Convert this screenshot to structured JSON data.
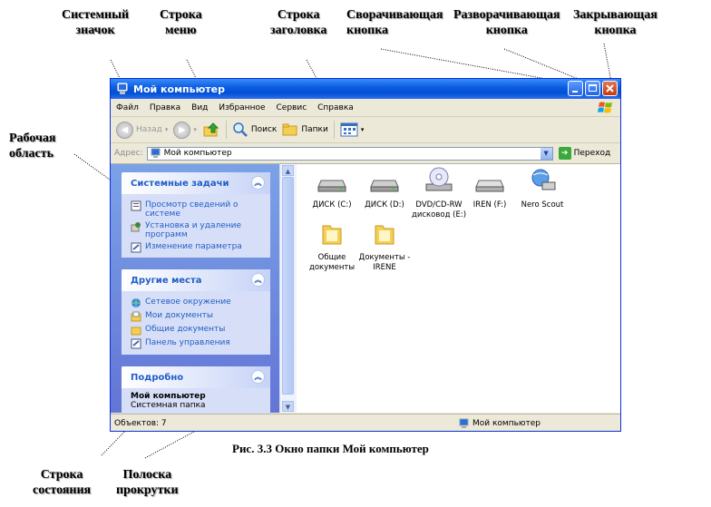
{
  "annotations": {
    "system_icon": "Системный\nзначок",
    "menu_bar": "Строка\nменю",
    "title_bar": "Строка\nзаголовка",
    "minimize_button": "Сворачивающая\nкнопка",
    "maximize_button": "Разворачивающая\nкнопка",
    "close_button": "Закрывающая\nкнопка",
    "work_area": "Рабочая\nобласть",
    "status_bar": "Строка\nсостояния",
    "scroll_bar": "Полоска\nпрокрутки"
  },
  "window": {
    "title": "Мой компьютер",
    "menu": [
      "Файл",
      "Правка",
      "Вид",
      "Избранное",
      "Сервис",
      "Справка"
    ],
    "toolbar": {
      "back": "Назад",
      "search": "Поиск",
      "folders": "Папки"
    },
    "address": {
      "label": "Адрес:",
      "value": "Мой компьютер",
      "go": "Переход"
    },
    "tasks": {
      "system": {
        "title": "Системные задачи",
        "items": [
          "Просмотр сведений о системе",
          "Установка и удаление программ",
          "Изменение параметра"
        ]
      },
      "places": {
        "title": "Другие места",
        "items": [
          "Сетевое окружение",
          "Мои документы",
          "Общие документы",
          "Панель управления"
        ]
      },
      "details": {
        "title": "Подробно",
        "name": "Мой компьютер",
        "type": "Системная папка"
      }
    },
    "files": [
      {
        "label": "ДИСК (C:)",
        "icon": "hard-drive-icon"
      },
      {
        "label": "ДИСК (D:)",
        "icon": "hard-drive-icon"
      },
      {
        "label": "DVD/CD-RW дисковод (E:)",
        "icon": "dvd-drive-icon"
      },
      {
        "label": "IREN (F:)",
        "icon": "removable-drive-icon"
      },
      {
        "label": "Nero Scout",
        "icon": "network-drive-icon"
      },
      {
        "label": "Общие документы",
        "icon": "folder-icon"
      },
      {
        "label": "Документы - IRENE",
        "icon": "folder-icon"
      }
    ],
    "status": {
      "objects": "Объектов: 7",
      "location": "Мой компьютер"
    }
  },
  "caption": "Рис. 3.3 Окно папки Мой компьютер"
}
